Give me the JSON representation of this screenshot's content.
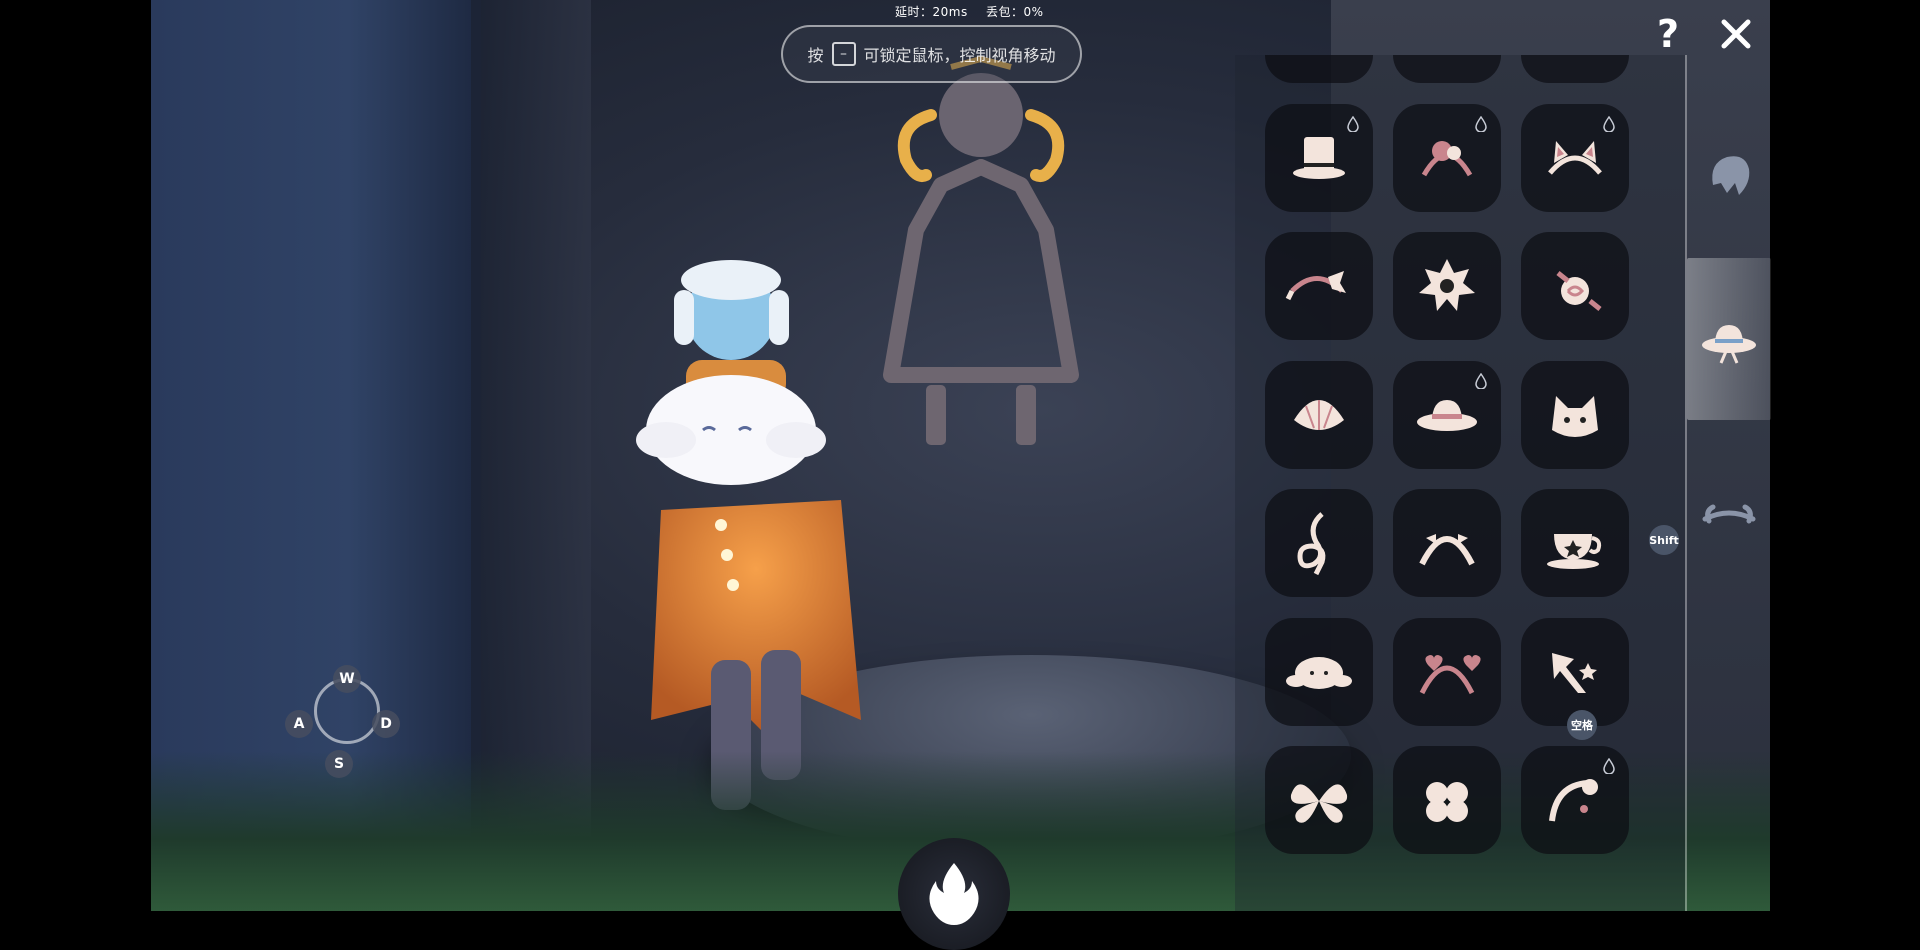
{
  "hud": {
    "latency_label": "延时：20ms",
    "packet_loss_label": "丢包：0%",
    "hint": {
      "prefix": "按",
      "key": "⎯",
      "text": "可锁定鼠标，控制视角移动"
    },
    "help_label": "?",
    "close_icon": "close-icon"
  },
  "controls": {
    "up": "W",
    "left": "A",
    "right": "D",
    "down": "S",
    "shift_badge": "Shift",
    "space_badge": "空格"
  },
  "wardrobe": {
    "rows": [
      [
        "bow-cat-ears-icon",
        "ribbon-headband-icon",
        "flower-clip-icon"
      ],
      [
        "top-hat-icon",
        "flower-headband-icon",
        "cat-ear-headband-icon"
      ],
      [
        "ribbon-bow-headband-icon",
        "star-flower-icon",
        "rose-clip-icon"
      ],
      [
        "seashell-clip-icon",
        "sun-hat-icon",
        "cat-mask-icon"
      ],
      [
        "treble-clef-icon",
        "bow-headband-icon",
        "teacup-icon"
      ],
      [
        "cinnamoroll-icon",
        "heart-headband-icon",
        "arrow-star-icon"
      ],
      [
        "butterfly-bow-icon",
        "clover-icon",
        "flower-hairpin-icon"
      ]
    ],
    "drop_marks": [
      [
        1,
        0
      ],
      [
        1,
        1
      ],
      [
        1,
        2
      ],
      [
        3,
        1
      ],
      [
        6,
        2
      ]
    ],
    "categories": [
      "hair-icon",
      "hat-icon",
      "horns-icon"
    ],
    "active_category": 1
  },
  "colors": {
    "icon": "#f3e4dc",
    "accent_pink": "#c9858d",
    "mural_gold": "#e8b04a"
  }
}
